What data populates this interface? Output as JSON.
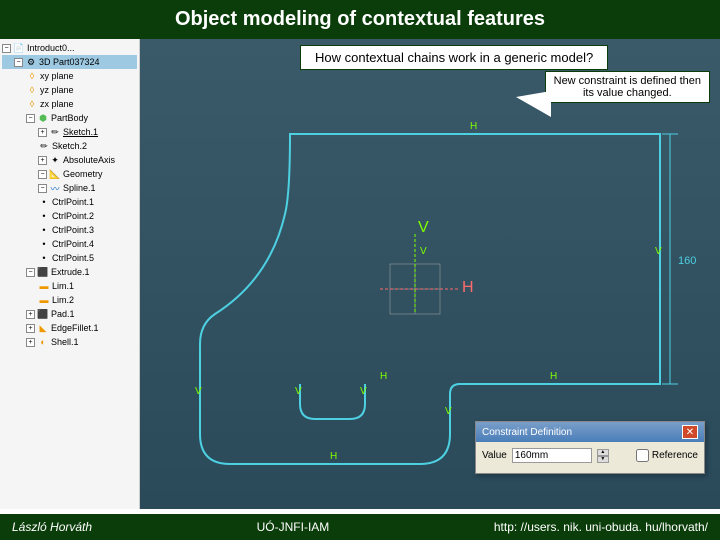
{
  "title": "Object modeling of contextual features",
  "callout1": "How contextual chains work in a generic model?",
  "callout2_l1": "New constraint is defined then",
  "callout2_l2": "its value changed.",
  "tree": {
    "root": "Introduct0...",
    "part": "3D Part037324",
    "items": [
      "xy plane",
      "yz plane",
      "zx plane",
      "PartBody"
    ],
    "sketch1": "Sketch.1",
    "sketch2": "Sketch.2",
    "absaxis": "AbsoluteAxis",
    "geom": "Geometry",
    "spline": "Spline.1",
    "cp1": "CtrlPoint.1",
    "cp2": "CtrlPoint.2",
    "cp3": "CtrlPoint.3",
    "cp4": "CtrlPoint.4",
    "cp5": "CtrlPoint.5",
    "extrude": "Extrude.1",
    "lim1": "Lim.1",
    "lim2": "Lim.2",
    "pad": "Pad.1",
    "edge": "EdgeFillet.1",
    "shell": "Shell.1"
  },
  "sketch": {
    "dim_value": "160",
    "axis_v": "V",
    "axis_h": "H",
    "cons_h": "H",
    "cons_v": "V"
  },
  "dialog": {
    "title": "Constraint Definition",
    "value_label": "Value",
    "value": "160mm",
    "reference": "Reference"
  },
  "footer": {
    "author": "László Horváth",
    "org": "UÓ-JNFI-IAM",
    "url": "http: //users. nik. uni-obuda. hu/lhorvath/"
  }
}
